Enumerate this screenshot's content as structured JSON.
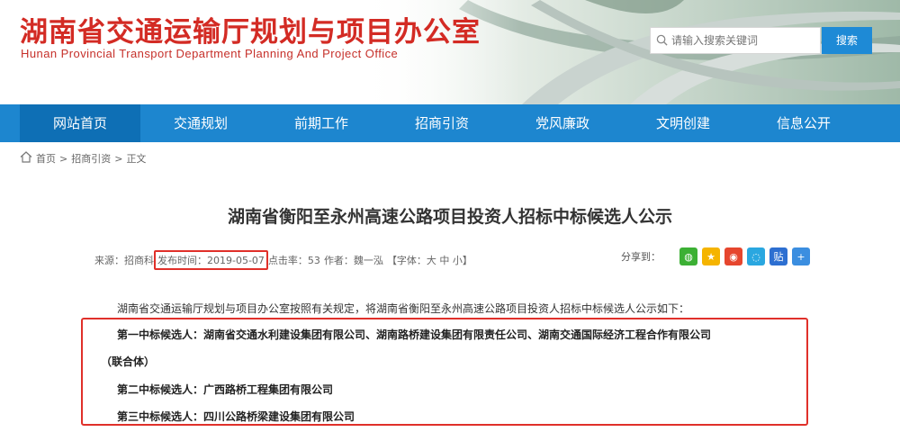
{
  "header": {
    "title": "湖南省交通运输厅规划与项目办公室",
    "subtitle": "Hunan Provincial Transport Department Planning And Project Office",
    "search_placeholder": "请输入搜索关键词",
    "search_button": "搜索"
  },
  "nav": {
    "items": [
      {
        "label": "网站首页"
      },
      {
        "label": "交通规划"
      },
      {
        "label": "前期工作"
      },
      {
        "label": "招商引资"
      },
      {
        "label": "党风廉政"
      },
      {
        "label": "文明创建"
      },
      {
        "label": "信息公开"
      }
    ]
  },
  "breadcrumb": {
    "home": "首页",
    "sep": ">",
    "section": "招商引资",
    "current": "正文"
  },
  "article": {
    "title": "湖南省衡阳至永州高速公路项目投资人招标中标候选人公示",
    "meta": {
      "source": "来源：招商科",
      "date": "发布时间：2019-05-07",
      "clicks": "点击率：53",
      "author": "作者：魏一泓",
      "font": "【字体：大 中 小】"
    },
    "share_label": "分享到：",
    "intro": "湖南省交通运输厅规划与项目办公室按照有关规定，将湖南省衡阳至永州高速公路项目投资人招标中标候选人公示如下：",
    "candidates": {
      "first_line1": "第一中标候选人：湖南省交通水利建设集团有限公司、湖南路桥建设集团有限责任公司、湖南交通国际经济工程合作有限公司",
      "first_line2": "（联合体）",
      "second": "第二中标候选人：广西路桥工程集团有限公司",
      "third": "第三中标候选人：四川公路桥梁建设集团有限公司"
    }
  },
  "colors": {
    "brand_red": "#d32b24",
    "nav_blue": "#1d86cf",
    "highlight_red": "#e0302a"
  }
}
